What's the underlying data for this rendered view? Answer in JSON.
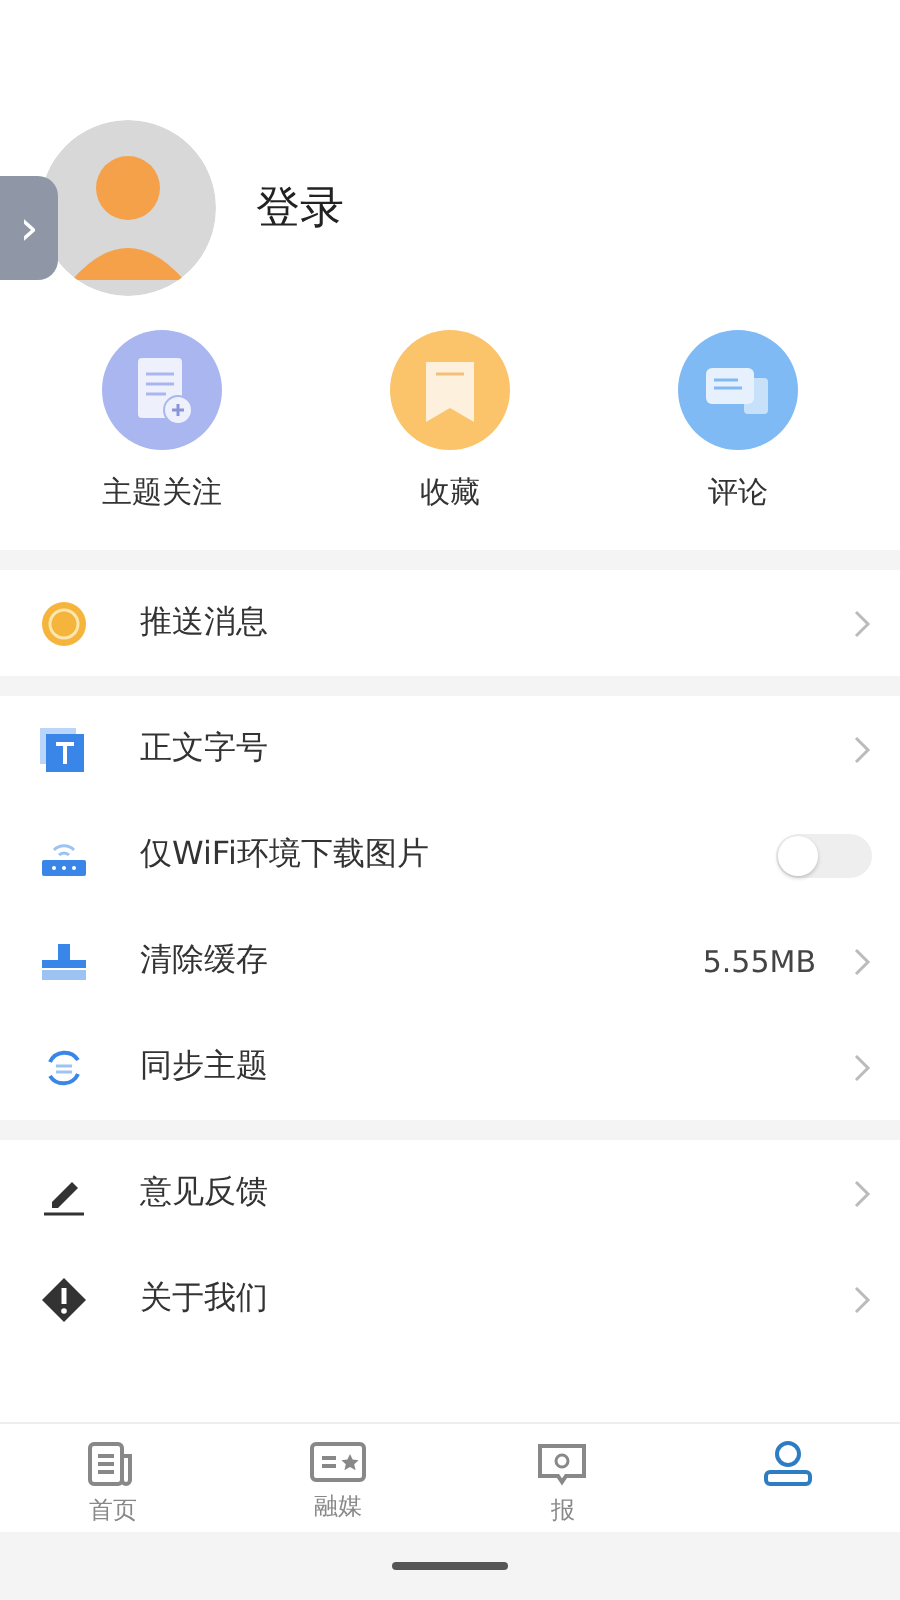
{
  "profile": {
    "login": "登录",
    "side_toggle": "›"
  },
  "shortcuts": [
    {
      "label": "主题关注",
      "kind": "topic",
      "color": "#a9b6f0"
    },
    {
      "label": "收藏",
      "kind": "favorite",
      "color": "#fbc36a"
    },
    {
      "label": "评论",
      "kind": "comment",
      "color": "#7fbaf5"
    }
  ],
  "groups": [
    [
      {
        "label": "推送消息",
        "kind": "push"
      }
    ],
    [
      {
        "label": "正文字号",
        "kind": "font"
      },
      {
        "label": "仅WiFi环境下载图片",
        "kind": "wifi",
        "on": false
      },
      {
        "label": "清除缓存",
        "kind": "clean",
        "value": "5.55MB"
      },
      {
        "label": "同步主题",
        "kind": "sync"
      }
    ],
    [
      {
        "label": "意见反馈",
        "kind": "pen"
      },
      {
        "label": "关于我们",
        "kind": "info"
      }
    ]
  ],
  "tabs": [
    {
      "label": "首页",
      "kind": "news",
      "selected": false
    },
    {
      "label": "融媒",
      "kind": "media",
      "selected": false
    },
    {
      "label": "报",
      "kind": "report",
      "selected": false
    },
    {
      "kind": "user",
      "selected": true
    }
  ]
}
